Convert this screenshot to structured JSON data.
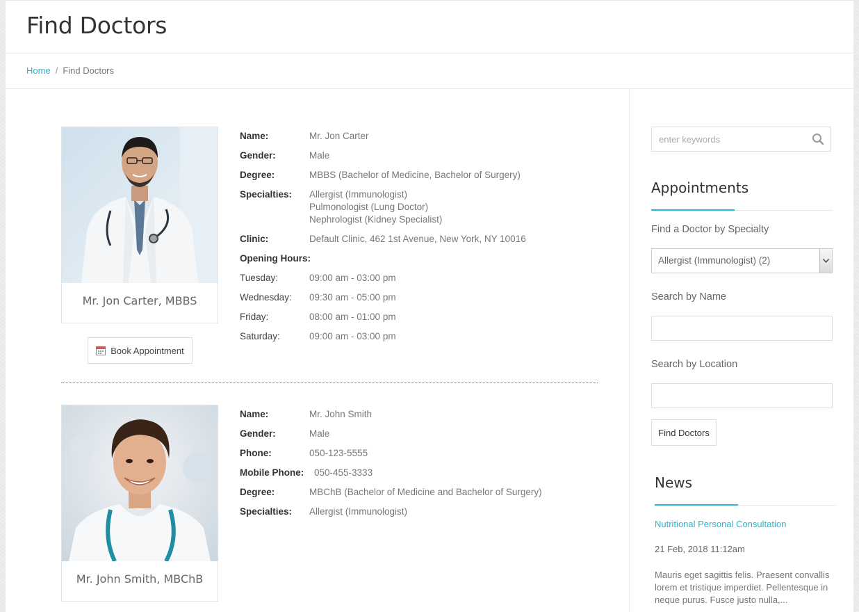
{
  "header": {
    "title": "Find Doctors"
  },
  "breadcrumb": {
    "home": "Home",
    "separator": "/",
    "current": "Find Doctors"
  },
  "doctors": [
    {
      "caption": "Mr. Jon Carter, MBBS",
      "book_label": "Book Appointment",
      "fields": [
        {
          "label": "Name:",
          "value": "Mr. Jon Carter"
        },
        {
          "label": "Gender:",
          "value": "Male"
        },
        {
          "label": "Degree:",
          "value": "MBBS (Bachelor of Medicine, Bachelor of Surgery)"
        },
        {
          "label": "Specialties:",
          "values": [
            "Allergist (Immunologist)",
            "Pulmonologist (Lung Doctor)",
            "Nephrologist (Kidney Specialist)"
          ]
        },
        {
          "label": "Clinic:",
          "value": "Default Clinic, 462 1st Avenue, New York, NY 10016"
        }
      ],
      "opening_hours_label": "Opening Hours:",
      "hours": [
        {
          "day": "Tuesday:",
          "time": "09:00 am - 03:00 pm"
        },
        {
          "day": "Wednesday:",
          "time": "09:30 am - 05:00 pm"
        },
        {
          "day": "Friday:",
          "time": "08:00 am - 01:00 pm"
        },
        {
          "day": "Saturday:",
          "time": "09:00 am - 03:00 pm"
        }
      ]
    },
    {
      "caption": "Mr. John Smith, MBChB",
      "fields": [
        {
          "label": "Name:",
          "value": "Mr. John Smith"
        },
        {
          "label": "Gender:",
          "value": "Male"
        },
        {
          "label": "Phone:",
          "value": "050-123-5555"
        },
        {
          "label": "Mobile Phone:",
          "value": "050-455-3333"
        },
        {
          "label": "Degree:",
          "value": "MBChB (Bachelor of Medicine and Bachelor of Surgery)"
        },
        {
          "label": "Specialties:",
          "value": "Allergist (Immunologist)"
        }
      ]
    }
  ],
  "sidebar": {
    "search_placeholder": "enter keywords",
    "appointments_title": "Appointments",
    "specialty_label": "Find a Doctor by Specialty",
    "specialty_selected": "Allergist (Immunologist) (2)",
    "name_label": "Search by Name",
    "location_label": "Search by Location",
    "find_button": "Find Doctors",
    "news_title": "News",
    "news_item": {
      "title": "Nutritional Personal Consultation",
      "date": "21 Feb, 2018 11:12am",
      "excerpt": "Mauris eget sagittis felis. Praesent convallis lorem et tristique imperdiet. Pellentesque in neque purus. Fusce justo nulla,..."
    }
  },
  "colors": {
    "accent": "#29b6d1"
  }
}
